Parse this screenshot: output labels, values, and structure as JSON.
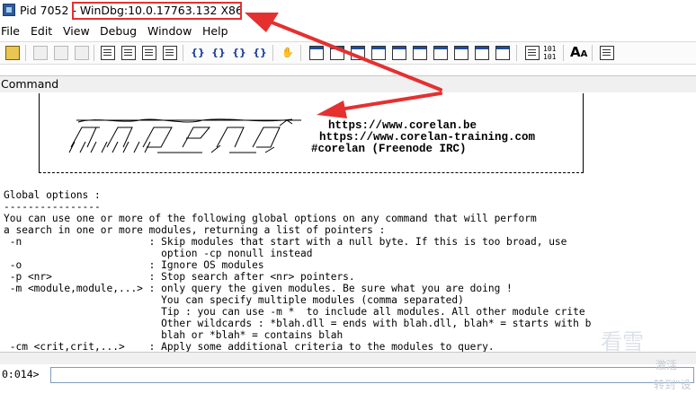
{
  "window": {
    "title_prefix": "Pid 7052 - ",
    "title_highlight": "WinDbg:10.0.17763.132 X86"
  },
  "menu": [
    "File",
    "Edit",
    "View",
    "Debug",
    "Window",
    "Help"
  ],
  "toolbar": {
    "icons": [
      "open-icon",
      "cut-icon",
      "copy-icon",
      "paste-icon",
      "source-mode-icon",
      "step-into-icon",
      "step-over-icon",
      "step-out-icon",
      "run-to-cursor-icon",
      "breakpoint-icon",
      "hand-icon",
      "command-window-icon",
      "watch-window-icon",
      "locals-window-icon",
      "registers-window-icon",
      "memory-window-icon",
      "call-stack-icon",
      "disassembly-icon",
      "scratch-pad-icon",
      "source-mode-toggle-icon",
      "hex-display-icon",
      "font-icon",
      "options-icon"
    ],
    "hex_label_top": "101",
    "hex_label_bottom": "101",
    "font_label": "A"
  },
  "pane": {
    "title": "Command"
  },
  "banner": {
    "url1": "https://www.corelan.be",
    "url2": "https://www.corelan-training.com",
    "irc": "#corelan (Freenode IRC)"
  },
  "output_lines": [
    "Global options :",
    "----------------",
    "You can use one or more of the following global options on any command that will perform",
    "a search in one or more modules, returning a list of pointers :",
    " -n                     : Skip modules that start with a null byte. If this is too broad, use",
    "                          option -cp nonull instead",
    " -o                     : Ignore OS modules",
    " -p <nr>                : Stop search after <nr> pointers.",
    " -m <module,module,...> : only query the given modules. Be sure what you are doing !",
    "                          You can specify multiple modules (comma separated)",
    "                          Tip : you can use -m *  to include all modules. All other module crite",
    "                          Other wildcards : *blah.dll = ends with blah.dll, blah* = starts with b",
    "                          blah or *blah* = contains blah",
    " -cm <crit,crit,...>    : Apply some additional criteria to the modules to query."
  ],
  "command": {
    "prompt": "0:014>",
    "value": "",
    "placeholder": ""
  },
  "watermark": {
    "big": "看雪",
    "line1": "激活",
    "line2": "转到\"设"
  },
  "colors": {
    "highlight": "#e53030",
    "arrow": "#e53030",
    "background": "#ffffff"
  }
}
